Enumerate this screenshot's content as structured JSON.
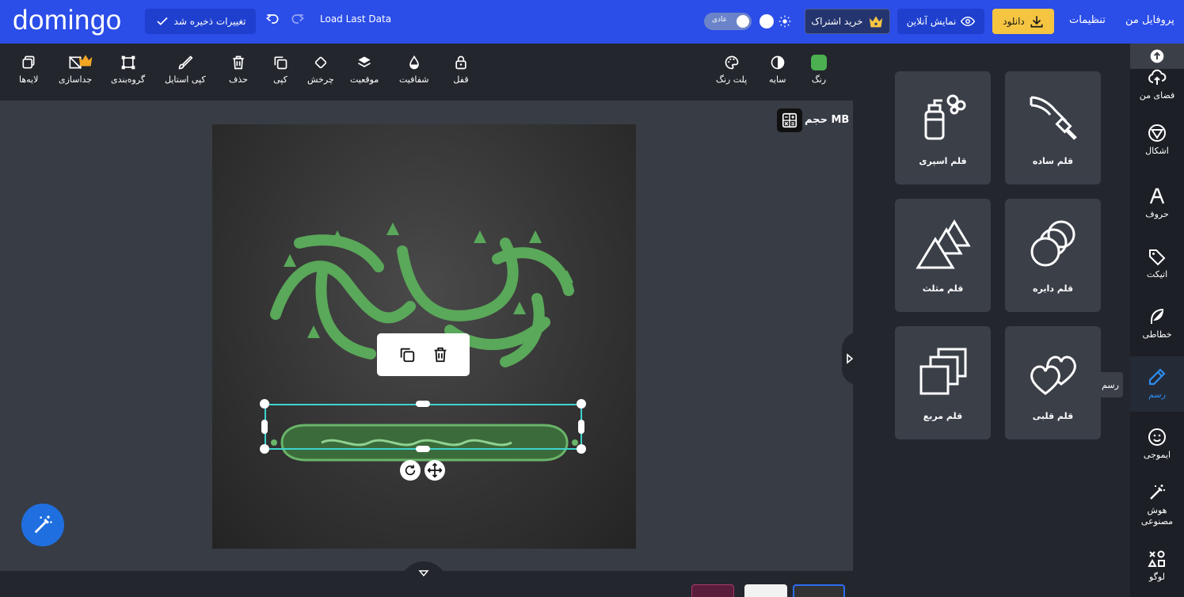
{
  "header": {
    "logo": "domingo",
    "save_status": "تغییرات ذخیره شد",
    "load_last": "Load Last Data",
    "mode_label": "عادی",
    "buy_label": "خرید اشتراک",
    "preview_label": "نمایش آنلاین",
    "download_label": "دانلود",
    "settings_label": "تنظیمات",
    "profile_label": "پروفایل من"
  },
  "toolbar": {
    "color": "رنگ",
    "shadow": "سایه",
    "palette": "پلت رنگ",
    "lock": "قفل",
    "opacity": "شفافیت",
    "position": "موقعیت",
    "rotate": "چرخش",
    "copy": "کپی",
    "delete": "حذف",
    "copy_style": "کپی استایل",
    "group": "گروه‌بندی",
    "ungroup": "جداسازی",
    "layers": "لایه‌ها"
  },
  "canvas": {
    "size_label": "حجم MB"
  },
  "panel": {
    "cards": [
      {
        "label": "قلم ساده",
        "icon": "brush-icon"
      },
      {
        "label": "قلم اسپری",
        "icon": "spray-can-icon"
      },
      {
        "label": "قلم دایره",
        "icon": "circles-icon"
      },
      {
        "label": "قلم مثلث",
        "icon": "triangles-icon"
      },
      {
        "label": "قلم قلبی",
        "icon": "hearts-icon"
      },
      {
        "label": "قلم مربع",
        "icon": "squares-icon"
      }
    ]
  },
  "rail": {
    "items": [
      {
        "label": "فضای من"
      },
      {
        "label": "اشکال"
      },
      {
        "label": "حروف"
      },
      {
        "label": "اتیکت"
      },
      {
        "label": "خطاطی"
      },
      {
        "label": "رسم"
      },
      {
        "label": "ایموجی"
      },
      {
        "label": "هوش مصنوعی"
      },
      {
        "label": "لوگو"
      }
    ],
    "tooltip": "رسم"
  },
  "colors": {
    "header_bg": "#2b4de8",
    "accent_yellow": "#f5c542",
    "selection": "#3ed4d0",
    "calligraphy_green": "#4caf50",
    "panel_bg": "#23262d"
  }
}
